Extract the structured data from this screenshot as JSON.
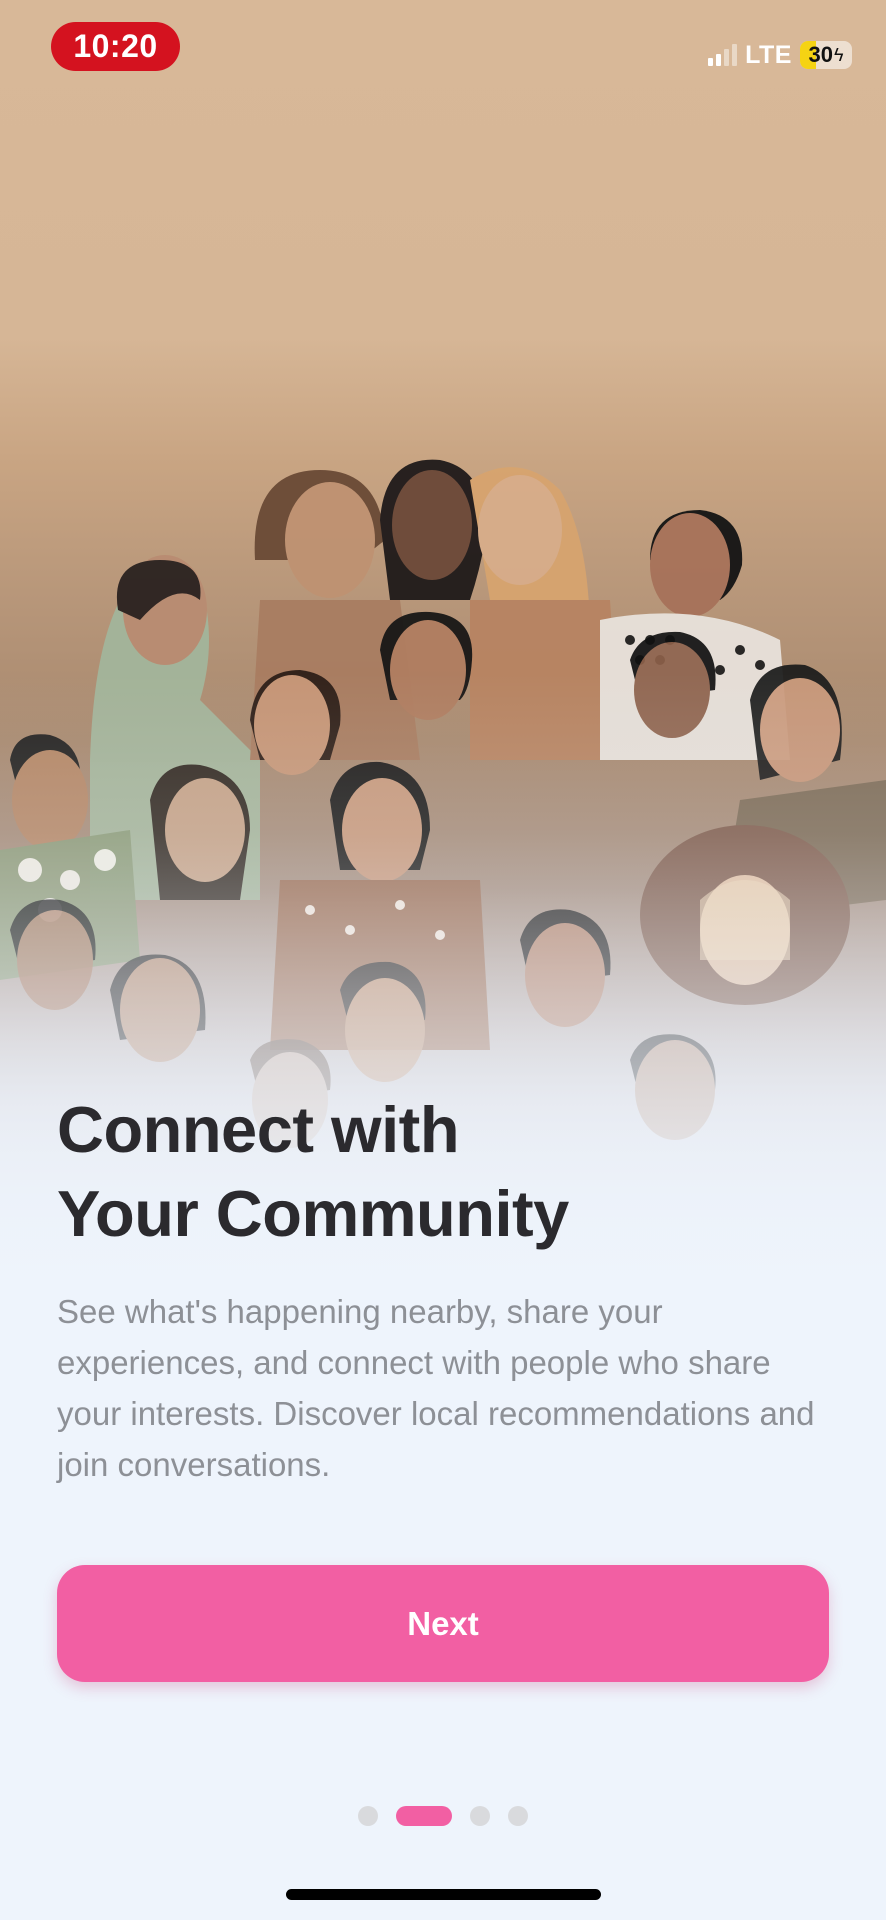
{
  "status_bar": {
    "time": "10:20",
    "network": "LTE",
    "battery": "30",
    "battery_level_percent": 30,
    "time_pill_color": "#d4121f"
  },
  "hero": {
    "icon": "community-illustration"
  },
  "content": {
    "title_line1": "Connect with",
    "title_line2": "Your Community",
    "description": "See what's happening nearby, share your experiences, and connect with people who share your interests. Discover local recommendations and join conversations."
  },
  "actions": {
    "next_label": "Next",
    "accent_color": "#f25fa3"
  },
  "pagination": {
    "total": 4,
    "current": 2
  }
}
